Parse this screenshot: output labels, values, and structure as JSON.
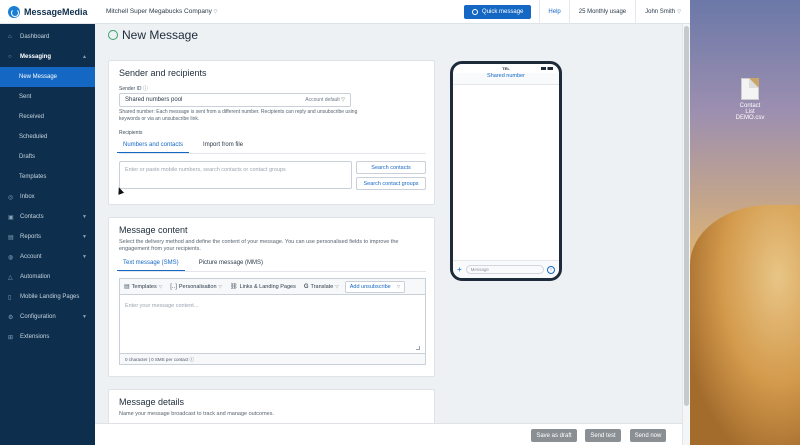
{
  "app": {
    "logo_text": "MessageMedia",
    "company": "Mitchell Super Megabucks Company",
    "quick_message": "Quick message",
    "help": "Help",
    "usage": "25 Monthly usage",
    "user": "John Smith"
  },
  "sidebar": {
    "items": [
      {
        "label": "Dashboard",
        "icon": "home-icon"
      },
      {
        "label": "Messaging",
        "icon": "chat-icon"
      },
      {
        "label": "New Message"
      },
      {
        "label": "Sent"
      },
      {
        "label": "Received"
      },
      {
        "label": "Scheduled"
      },
      {
        "label": "Drafts"
      },
      {
        "label": "Templates"
      },
      {
        "label": "Inbox",
        "icon": "inbox-icon"
      },
      {
        "label": "Contacts",
        "icon": "contacts-icon"
      },
      {
        "label": "Reports",
        "icon": "reports-icon"
      },
      {
        "label": "Account",
        "icon": "account-icon"
      },
      {
        "label": "Automation",
        "icon": "automation-icon"
      },
      {
        "label": "Mobile Landing Pages",
        "icon": "mobile-icon"
      },
      {
        "label": "Configuration",
        "icon": "config-icon"
      },
      {
        "label": "Extensions",
        "icon": "extensions-icon"
      }
    ]
  },
  "page": {
    "title": "New Message"
  },
  "sender": {
    "heading": "Sender and recipients",
    "sender_id_label": "Sender ID",
    "sender_value": "Shared numbers pool",
    "sender_default": "Account default",
    "hint": "Shared number: Each message is sent from a different number. Recipients can reply and unsubscribe using keywords or via an unsubscribe link.",
    "recipients_label": "Recipients",
    "tab_numbers": "Numbers and contacts",
    "tab_import": "Import from file",
    "recipients_placeholder": "Enter or paste mobile numbers, search contacts or contact groups",
    "search_contacts": "Search contacts",
    "search_groups": "Search contact groups"
  },
  "content": {
    "heading": "Message content",
    "description": "Select the delivery method and define the content of your message. You can use personalised fields to improve the engagement from your recipients.",
    "tab_sms": "Text message (SMS)",
    "tab_mms": "Picture message (MMS)",
    "tool_templates": "Templates",
    "tool_personalisation": "Personalisation",
    "tool_links": "Links & Landing Pages",
    "tool_translate": "Translate",
    "tool_unsubscribe": "Add unsubscribe",
    "message_placeholder": "Enter your message content...",
    "counter": "0 character | 0 SMS per contact"
  },
  "details": {
    "heading": "Message details",
    "description": "Name your message broadcast to track and manage outcomes."
  },
  "phone": {
    "carrier": "TEL",
    "header": "Shared number",
    "input_placeholder": "Message"
  },
  "actions": {
    "save_draft": "Save as draft",
    "send_test": "Send test",
    "send_now": "Send now"
  },
  "desktop": {
    "file_label": "Contact List DEMO.csv"
  },
  "colors": {
    "accent": "#1468c4",
    "sidebar": "#0d2f4d",
    "active": "#1468c4"
  }
}
